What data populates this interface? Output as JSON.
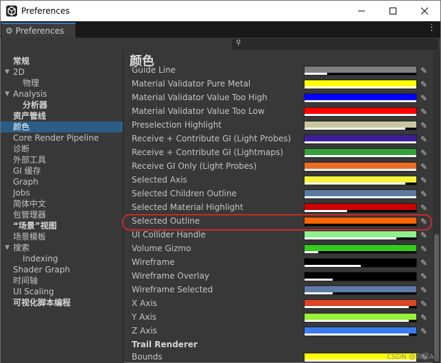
{
  "window": {
    "title": "Preferences",
    "tab_label": "Preferences",
    "controls": [
      "—",
      "☐",
      "✕"
    ]
  },
  "sidebar": {
    "items": [
      {
        "label": "常规",
        "indent": 0,
        "bold": true,
        "arrow": ""
      },
      {
        "label": "2D",
        "indent": 0,
        "bold": false,
        "arrow": "▼"
      },
      {
        "label": "物理",
        "indent": 1,
        "bold": false,
        "arrow": ""
      },
      {
        "label": "Analysis",
        "indent": 0,
        "bold": false,
        "arrow": "▼"
      },
      {
        "label": "分析器",
        "indent": 1,
        "bold": true,
        "arrow": ""
      },
      {
        "label": "资产管线",
        "indent": 0,
        "bold": true,
        "arrow": ""
      },
      {
        "label": "颜色",
        "indent": 0,
        "bold": false,
        "arrow": "",
        "selected": true
      },
      {
        "label": "Core Render Pipeline",
        "indent": 0,
        "bold": false,
        "arrow": ""
      },
      {
        "label": "诊断",
        "indent": 0,
        "bold": false,
        "arrow": ""
      },
      {
        "label": "外部工具",
        "indent": 0,
        "bold": false,
        "arrow": ""
      },
      {
        "label": "GI 缓存",
        "indent": 0,
        "bold": false,
        "arrow": ""
      },
      {
        "label": "Graph",
        "indent": 0,
        "bold": false,
        "arrow": ""
      },
      {
        "label": "Jobs",
        "indent": 0,
        "bold": false,
        "arrow": ""
      },
      {
        "label": "简体中文",
        "indent": 0,
        "bold": false,
        "arrow": ""
      },
      {
        "label": "包管理器",
        "indent": 0,
        "bold": false,
        "arrow": ""
      },
      {
        "label": "“场景”视图",
        "indent": 0,
        "bold": true,
        "arrow": ""
      },
      {
        "label": "场景模板",
        "indent": 0,
        "bold": false,
        "arrow": ""
      },
      {
        "label": "搜索",
        "indent": 0,
        "bold": false,
        "arrow": "▼"
      },
      {
        "label": "Indexing",
        "indent": 1,
        "bold": false,
        "arrow": ""
      },
      {
        "label": "Shader Graph",
        "indent": 0,
        "bold": false,
        "arrow": ""
      },
      {
        "label": "时间轴",
        "indent": 0,
        "bold": false,
        "arrow": ""
      },
      {
        "label": "UI Scaling",
        "indent": 0,
        "bold": false,
        "arrow": ""
      },
      {
        "label": "可视化脚本编程",
        "indent": 0,
        "bold": true,
        "arrow": ""
      }
    ]
  },
  "main": {
    "section_title": "颜色",
    "colors": [
      {
        "label": "Guide Line",
        "color": "#808080",
        "alpha": 0.2
      },
      {
        "label": "Material Validator Pure Metal",
        "color": "#ffff00",
        "alpha": 1
      },
      {
        "label": "Material Validator Value Too High",
        "color": "#0000ff",
        "alpha": 1
      },
      {
        "label": "Material Validator Value Too Low",
        "color": "#ff0000",
        "alpha": 1
      },
      {
        "label": "Preselection Highlight",
        "color": "#c8c8a0",
        "alpha": 0.9
      },
      {
        "label": "Receive + Contribute GI (Light Probes)",
        "color": "#3c1e9c",
        "alpha": 1
      },
      {
        "label": "Receive + Contribute GI (Lightmaps)",
        "color": "#33a03a",
        "alpha": 1
      },
      {
        "label": "Receive GI Only (Light Probes)",
        "color": "#ee6b22",
        "alpha": 1
      },
      {
        "label": "Selected Axis",
        "color": "#f2f23c",
        "alpha": 0.9
      },
      {
        "label": "Selected Children Outline",
        "color": "#5c7a9e",
        "alpha": 1
      },
      {
        "label": "Selected Material Highlight",
        "color": "#cc0000",
        "alpha": 0.38
      },
      {
        "label": "Selected Outline",
        "color": "#ff6600",
        "alpha": 0
      },
      {
        "label": "UI Collider Handle",
        "color": "#8ef08c",
        "alpha": 0.82
      },
      {
        "label": "Volume Gizmo",
        "color": "#34cc1e",
        "alpha": 0.12
      },
      {
        "label": "Wireframe",
        "color": "#000000",
        "alpha": 0.5
      },
      {
        "label": "Wireframe Overlay",
        "color": "#000000",
        "alpha": 0.25
      },
      {
        "label": "Wireframe Selected",
        "color": "#5e7aa6",
        "alpha": 0.25
      },
      {
        "label": "X Axis",
        "color": "#db4426",
        "alpha": 0.93
      },
      {
        "label": "Y Axis",
        "color": "#98f03a",
        "alpha": 0.93
      },
      {
        "label": "Z Axis",
        "color": "#3a7cf0",
        "alpha": 0.93
      }
    ],
    "subheader": "Trail Renderer",
    "trail_colors": [
      {
        "label": "Bounds",
        "color": "#ffff00",
        "alpha": 1
      }
    ]
  },
  "watermark": "CSDN @灰尿A"
}
